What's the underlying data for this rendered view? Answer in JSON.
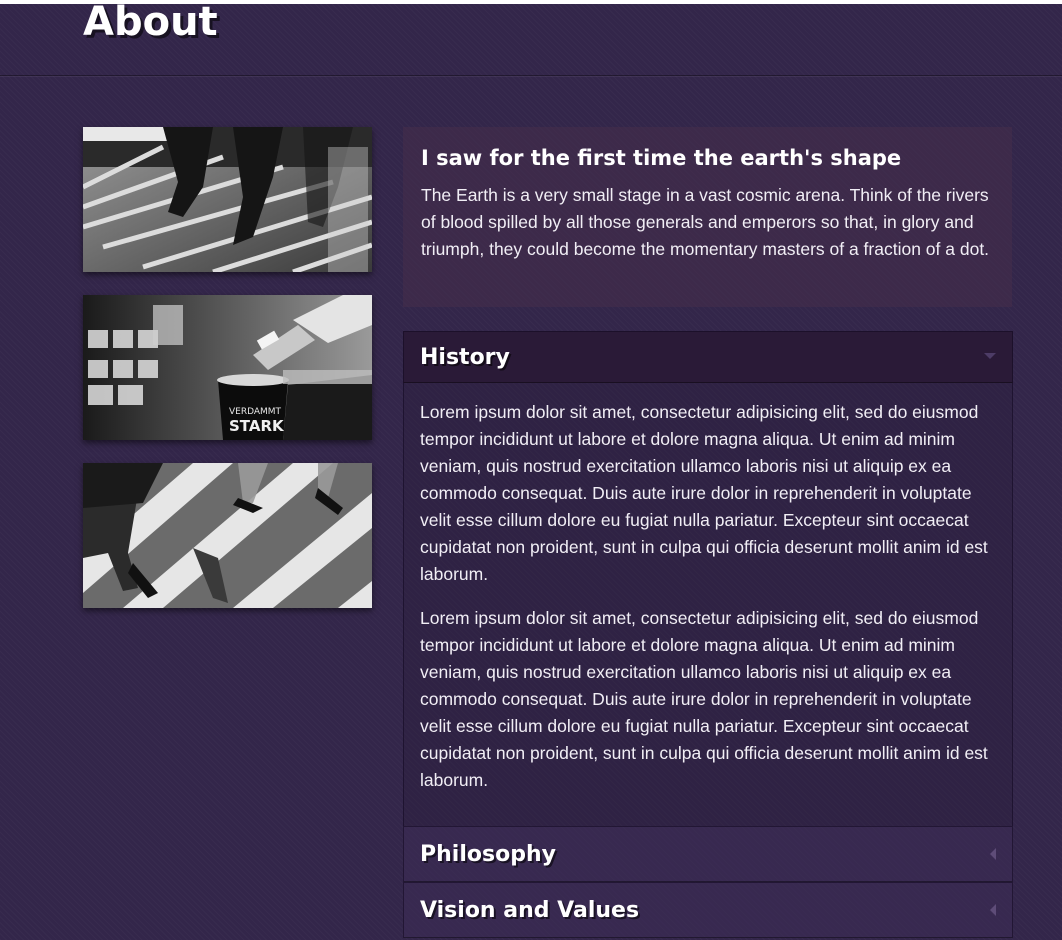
{
  "header": {
    "title": "About"
  },
  "intro": {
    "heading": "I saw for the first time the earth's shape",
    "text": "The Earth is a very small stage in a vast cosmic arena. Think of the rivers of blood spilled by all those generals and emperors so that, in glory and triumph, they could become the momentary masters of a fraction of a dot."
  },
  "photos": {
    "cup_label_1": "VERDAMMT",
    "cup_label_2": "STARK"
  },
  "accordion": {
    "history": {
      "title": "History",
      "paragraphs": [
        "Lorem ipsum dolor sit amet, consectetur adipisicing elit, sed do eiusmod tempor incididunt ut labore et dolore magna aliqua. Ut enim ad minim veniam, quis nostrud exercitation ullamco laboris nisi ut aliquip ex ea commodo consequat. Duis aute irure dolor in reprehenderit in voluptate velit esse cillum dolore eu fugiat nulla pariatur. Excepteur sint occaecat cupidatat non proident, sunt in culpa qui officia deserunt mollit anim id est laborum.",
        "Lorem ipsum dolor sit amet, consectetur adipisicing elit, sed do eiusmod tempor incididunt ut labore et dolore magna aliqua. Ut enim ad minim veniam, quis nostrud exercitation ullamco laboris nisi ut aliquip ex ea commodo consequat. Duis aute irure dolor in reprehenderit in voluptate velit esse cillum dolore eu fugiat nulla pariatur. Excepteur sint occaecat cupidatat non proident, sunt in culpa qui officia deserunt mollit anim id est laborum."
      ]
    },
    "philosophy": {
      "title": "Philosophy"
    },
    "vision": {
      "title": "Vision and Values"
    }
  },
  "colors": {
    "background": "#33264a",
    "active_header": "#2a1a37",
    "text": "#ffffff"
  }
}
